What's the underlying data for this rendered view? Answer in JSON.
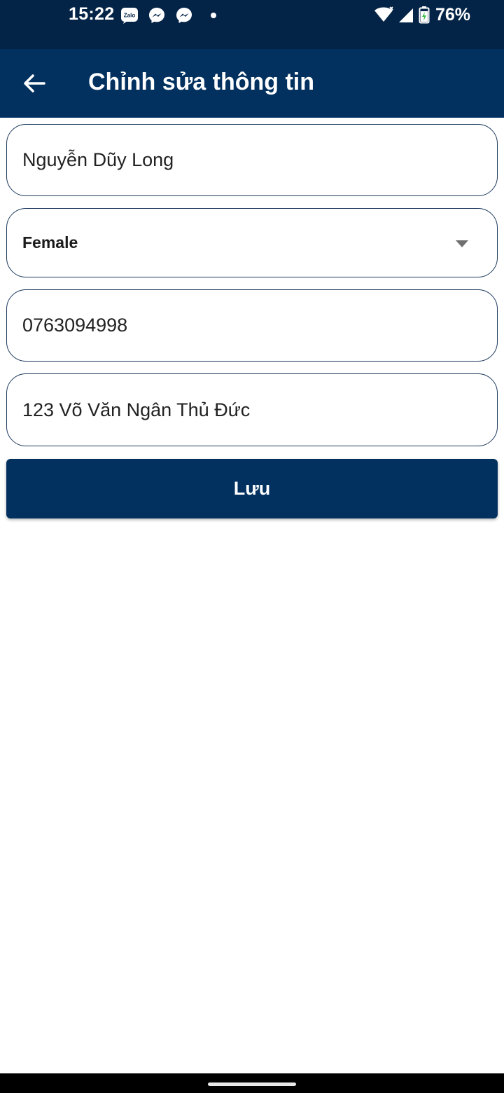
{
  "status_bar": {
    "time": "15:22",
    "notification_icons": [
      "zalo-icon",
      "messenger-icon",
      "messenger-icon",
      "dot-icon"
    ],
    "battery_percent": "76%",
    "icons_right": [
      "wifi-icon",
      "cell-signal-icon",
      "battery-charging-icon"
    ]
  },
  "app_bar": {
    "title": "Chỉnh sửa thông tin",
    "back_icon": "arrow-left-icon"
  },
  "form": {
    "name_value": "Nguyễn Dũy Long",
    "gender_value": "Female",
    "phone_value": "0763094998",
    "address_value": "123 Võ Văn Ngân Thủ Đức",
    "save_label": "Lưu"
  },
  "colors": {
    "status_bar": "#042447",
    "app_bar": "#02315f",
    "button": "#02315f",
    "field_border": "#1d3a5c"
  }
}
